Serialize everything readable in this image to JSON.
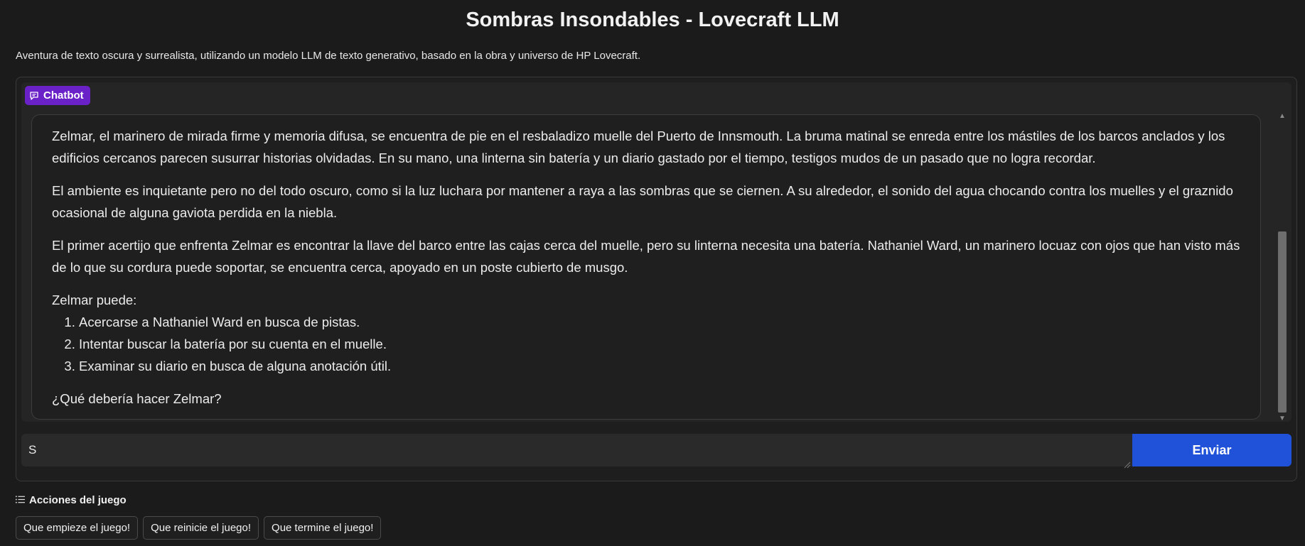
{
  "header": {
    "title": "Sombras Insondables - Lovecraft LLM",
    "subtitle": "Aventura de texto oscura y surrealista, utilizando un modelo LLM de texto generativo, basado en la obra y universo de HP Lovecraft."
  },
  "chatbot": {
    "label": "Chatbot",
    "label_icon": "chat-bubble-icon",
    "message": {
      "paragraphs": [
        "Zelmar, el marinero de mirada firme y memoria difusa, se encuentra de pie en el resbaladizo muelle del Puerto de Innsmouth. La bruma matinal se enreda entre los mástiles de los barcos anclados y los edificios cercanos parecen susurrar historias olvidadas. En su mano, una linterna sin batería y un diario gastado por el tiempo, testigos mudos de un pasado que no logra recordar.",
        "El ambiente es inquietante pero no del todo oscuro, como si la luz luchara por mantener a raya a las sombras que se ciernen. A su alrededor, el sonido del agua chocando contra los muelles y el graznido ocasional de alguna gaviota perdida en la niebla.",
        "El primer acertijo que enfrenta Zelmar es encontrar la llave del barco entre las cajas cerca del muelle, pero su linterna necesita una batería. Nathaniel Ward, un marinero locuaz con ojos que han visto más de lo que su cordura puede soportar, se encuentra cerca, apoyado en un poste cubierto de musgo."
      ],
      "options_intro": "Zelmar puede:",
      "options": [
        "Acercarse a Nathaniel Ward en busca de pistas.",
        "Intentar buscar la batería por su cuenta en el muelle.",
        "Examinar su diario en busca de alguna anotación útil."
      ],
      "question": "¿Qué debería hacer Zelmar?"
    }
  },
  "input": {
    "value": "S",
    "send_label": "Enviar"
  },
  "actions": {
    "label": "Acciones del juego",
    "label_icon": "list-icon",
    "buttons": [
      "Que empieze el juego!",
      "Que reinicie el juego!",
      "Que termine el juego!"
    ]
  },
  "colors": {
    "background": "#1b1b1b",
    "chatbot_badge": "#6b21c8",
    "send_button": "#1f52d8"
  }
}
